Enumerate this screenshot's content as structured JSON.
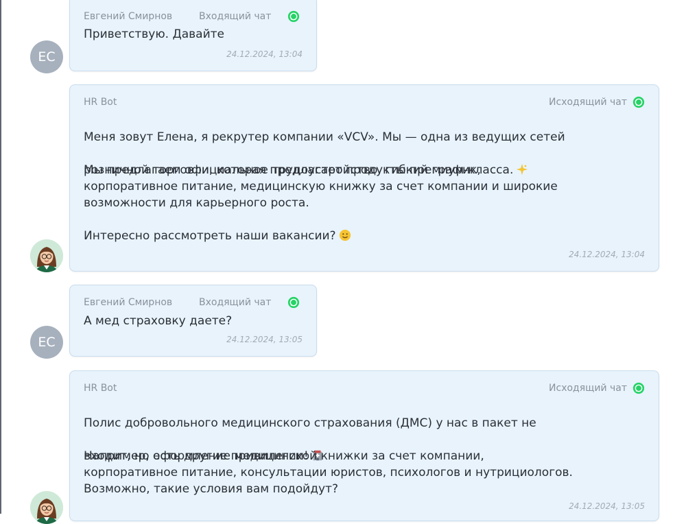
{
  "messages": [
    {
      "sender": "Евгений Смирнов",
      "chat_type": "Входящий чат",
      "avatar_initials": "ЕС",
      "text": "Приветствую. Давайте",
      "time": "24.12.2024, 13:04"
    },
    {
      "sender": "HR Bot",
      "chat_type": "Исходящий чат",
      "line1": "Меня зовут Елена, я рекрутер компании «VCV». Мы — одна из ведущих сетей",
      "line2": "розничной торговли, которая предлагает продукты премиум-класса.",
      "line2_emoji": "sparkle-emoji",
      "para2": "Мы предлагаем официальное трудоустройство, гибкий график,\nкорпоративное питание, медицинскую книжку за счет компании и широкие\nвозможности для карьерного роста.",
      "para3": "Интересно рассмотреть наши вакансии?",
      "para3_emoji": "smile-emoji",
      "time": "24.12.2024, 13:04"
    },
    {
      "sender": "Евгений Смирнов",
      "chat_type": "Входящий чат",
      "avatar_initials": "ЕС",
      "text": "А мед страховку даете?",
      "time": "24.12.2024, 13:05"
    },
    {
      "sender": "HR Bot",
      "chat_type": "Исходящий чат",
      "line1": "Полис добровольного медицинского страхования (ДМС) у нас в пакет не",
      "line2": "входит, но есть другие привилегии!",
      "line2_emoji": "hospital-emoji",
      "para2": "Например, оформление медицинской книжки за счет компании,\nкорпоративное питание, консультации юристов, психологов и нутрициологов.\nВозможно, такие условия вам подойдут?",
      "time": "24.12.2024, 13:05"
    }
  ],
  "colors": {
    "bubble_bg": "#e8f3fc",
    "bubble_border": "#c9dced",
    "whatsapp_green": "#25d366",
    "avatar_grey": "#a7b1bd"
  },
  "icons": {
    "channel": "whatsapp-icon",
    "bot_avatar": "recruiter-avatar"
  }
}
